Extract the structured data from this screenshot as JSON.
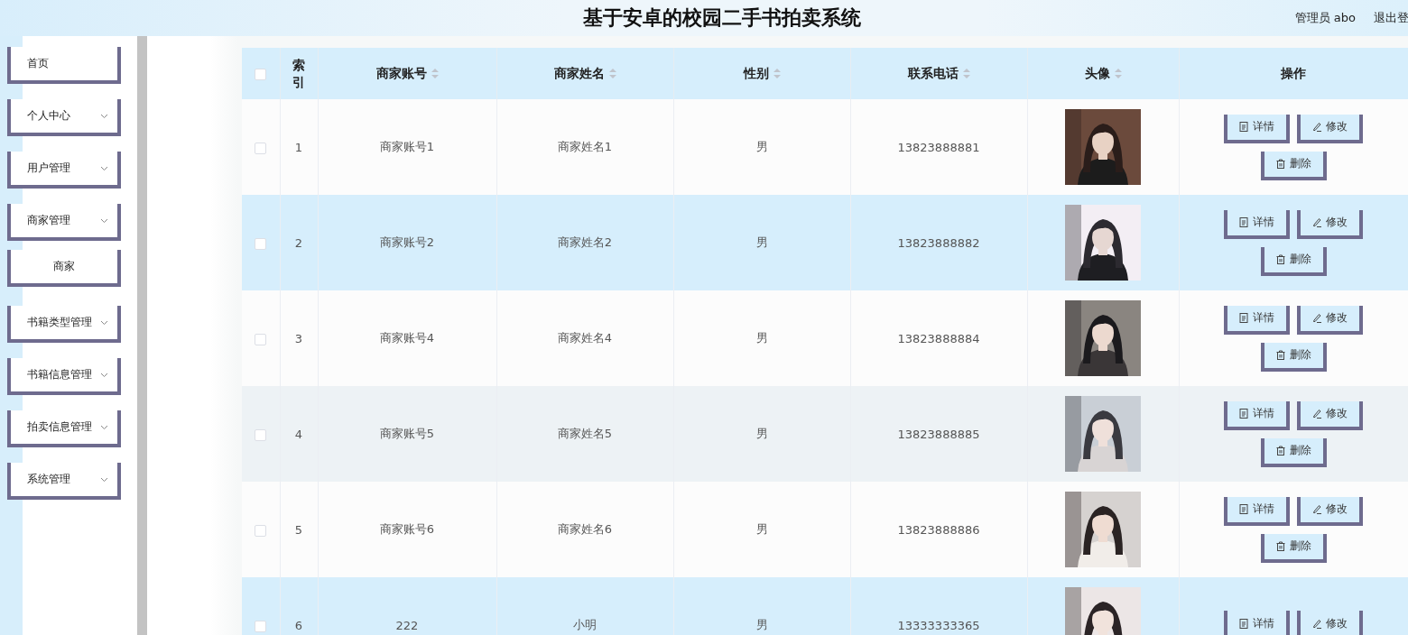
{
  "header": {
    "title": "基于安卓的校园二手书拍卖系统",
    "user": "管理员 abo",
    "logout": "退出登"
  },
  "sidebar": {
    "items": [
      {
        "label": "首页",
        "expandable": false
      },
      {
        "label": "个人中心",
        "expandable": true
      },
      {
        "label": "用户管理",
        "expandable": true
      },
      {
        "label": "商家管理",
        "expandable": true,
        "children": [
          {
            "label": "商家"
          }
        ]
      },
      {
        "label": "书籍类型管理",
        "expandable": true
      },
      {
        "label": "书籍信息管理",
        "expandable": true
      },
      {
        "label": "拍卖信息管理",
        "expandable": true
      },
      {
        "label": "系统管理",
        "expandable": true
      }
    ]
  },
  "table": {
    "select_all_checked": false,
    "columns": [
      {
        "label": "索引",
        "sortable": false
      },
      {
        "label": "商家账号",
        "sortable": true
      },
      {
        "label": "商家姓名",
        "sortable": true
      },
      {
        "label": "性别",
        "sortable": true
      },
      {
        "label": "联系电话",
        "sortable": true
      },
      {
        "label": "头像",
        "sortable": true
      },
      {
        "label": "操作",
        "sortable": false
      }
    ],
    "rows": [
      {
        "checked": false,
        "hovered": false,
        "index": "1",
        "account": "商家账号1",
        "name": "商家姓名1",
        "gender": "男",
        "phone": "13823888881",
        "avatar": {
          "kind": "picture"
        },
        "actions": [
          {
            "kind": "detail",
            "label": "详情"
          },
          {
            "kind": "edit",
            "label": "修改"
          },
          {
            "kind": "delete",
            "label": "删除"
          }
        ]
      },
      {
        "checked": false,
        "hovered": false,
        "index": "2",
        "account": "商家账号2",
        "name": "商家姓名2",
        "gender": "男",
        "phone": "13823888882",
        "avatar": {
          "kind": "picture"
        },
        "actions": [
          {
            "kind": "detail",
            "label": "详情"
          },
          {
            "kind": "edit",
            "label": "修改"
          },
          {
            "kind": "delete",
            "label": "删除"
          }
        ]
      },
      {
        "checked": false,
        "hovered": false,
        "index": "3",
        "account": "商家账号4",
        "name": "商家姓名4",
        "gender": "男",
        "phone": "13823888884",
        "avatar": {
          "kind": "picture"
        },
        "actions": [
          {
            "kind": "detail",
            "label": "详情"
          },
          {
            "kind": "edit",
            "label": "修改"
          },
          {
            "kind": "delete",
            "label": "删除"
          }
        ]
      },
      {
        "checked": false,
        "hovered": true,
        "index": "4",
        "account": "商家账号5",
        "name": "商家姓名5",
        "gender": "男",
        "phone": "13823888885",
        "avatar": {
          "kind": "picture"
        },
        "actions": [
          {
            "kind": "detail",
            "label": "详情"
          },
          {
            "kind": "edit",
            "label": "修改"
          },
          {
            "kind": "delete",
            "label": "删除"
          }
        ]
      },
      {
        "checked": false,
        "hovered": false,
        "index": "5",
        "account": "商家账号6",
        "name": "商家姓名6",
        "gender": "男",
        "phone": "13823888886",
        "avatar": {
          "kind": "picture"
        },
        "actions": [
          {
            "kind": "detail",
            "label": "详情"
          },
          {
            "kind": "edit",
            "label": "修改"
          },
          {
            "kind": "delete",
            "label": "删除"
          }
        ]
      },
      {
        "checked": false,
        "hovered": false,
        "index": "6",
        "account": "222",
        "name": "小明",
        "gender": "男",
        "phone": "13333333365",
        "avatar": {
          "kind": "picture"
        },
        "actions": [
          {
            "kind": "detail",
            "label": "详情"
          },
          {
            "kind": "edit",
            "label": "修改"
          }
        ]
      }
    ]
  }
}
